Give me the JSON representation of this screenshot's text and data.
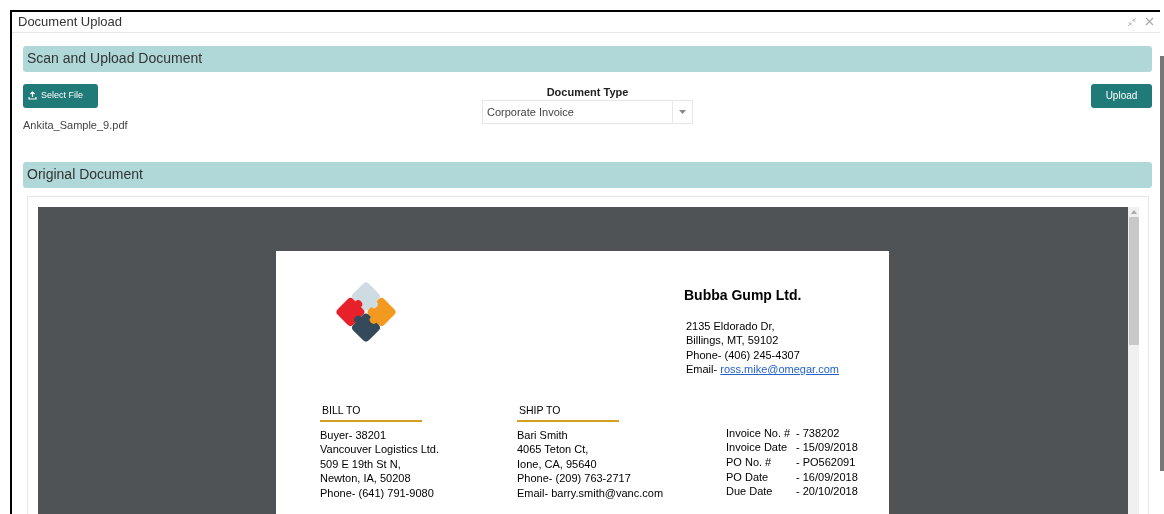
{
  "window": {
    "title": "Document Upload"
  },
  "scan_section": {
    "title": "Scan and Upload Document",
    "select_button": "Select File",
    "file_name": "Ankita_Sample_9.pdf",
    "document_type": {
      "label": "Document Type",
      "value": "Corporate Invoice"
    },
    "upload_button": "Upload"
  },
  "original_section": {
    "title": "Original Document"
  },
  "invoice": {
    "company": "Bubba Gump Ltd.",
    "company_lines": [
      "2135 Eldorado Dr,",
      "Billings, MT, 59102",
      "Phone- (406) 245-4307"
    ],
    "email_label": "Email- ",
    "email": "ross.mike@omegar.com",
    "bill_to": {
      "heading": "BILL TO",
      "lines": [
        "Buyer- 38201",
        "Vancouver Logistics Ltd.",
        "509 E 19th St N,",
        "Newton, IA, 50208",
        "Phone- (641) 791-9080"
      ]
    },
    "ship_to": {
      "heading": "SHIP TO",
      "lines": [
        "Bari Smith",
        "4065 Teton Ct,",
        "Ione, CA, 95640",
        "Phone- (209) 763-2717",
        "Email- barry.smith@vanc.com"
      ]
    },
    "details": [
      {
        "label": "Invoice No. #",
        "value": "- 738202"
      },
      {
        "label": "Invoice Date",
        "value": "- 15/09/2018"
      },
      {
        "label": "PO No. #",
        "value": "- PO562091"
      },
      {
        "label": "PO Date",
        "value": "- 16/09/2018"
      },
      {
        "label": "Due Date",
        "value": "- 20/10/2018"
      }
    ]
  }
}
